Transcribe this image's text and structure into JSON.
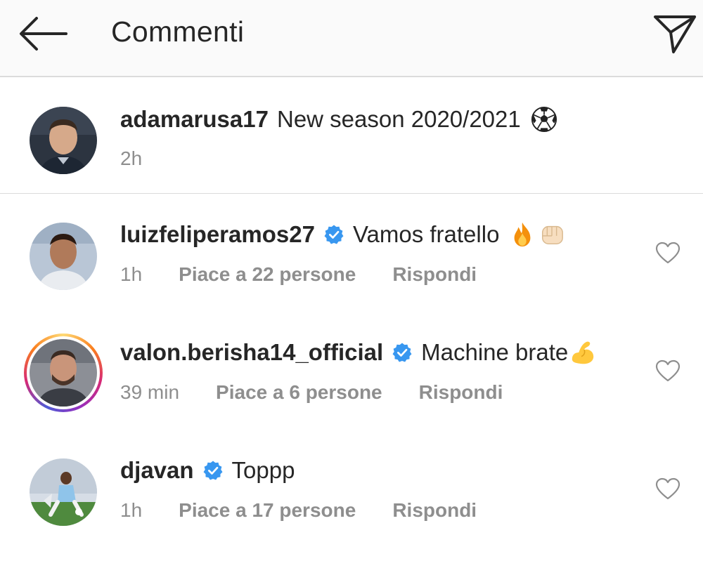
{
  "header": {
    "title": "Commenti",
    "back_icon": "arrow-left-icon",
    "send_icon": "paper-plane-icon"
  },
  "caption": {
    "username": "adamarusa17",
    "text": "New season 2020/2021",
    "emoji": "soccer-ball-emoji",
    "time": "2h"
  },
  "comments": [
    {
      "username": "luizfeliperamos27",
      "verified": true,
      "text": "Vamos fratello",
      "emojis": [
        "fire-emoji",
        "fist-emoji"
      ],
      "time": "1h",
      "likes": "Piace a 22 persone",
      "reply": "Rispondi"
    },
    {
      "username": "valon.berisha14_official",
      "verified": true,
      "story_ring": true,
      "text": "Machine brate",
      "emojis": [
        "flexed-biceps-emoji"
      ],
      "time": "39 min",
      "likes": "Piace a 6 persone",
      "reply": "Rispondi"
    },
    {
      "username": "djavan",
      "verified": true,
      "text": "Toppp",
      "emojis": [],
      "time": "1h",
      "likes": "Piace a 17 persone",
      "reply": "Rispondi"
    }
  ],
  "colors": {
    "verified": "#3897f0",
    "meta_text": "#8e8e8e",
    "divider": "#dbdbdb",
    "header_bg": "#fafafa"
  }
}
